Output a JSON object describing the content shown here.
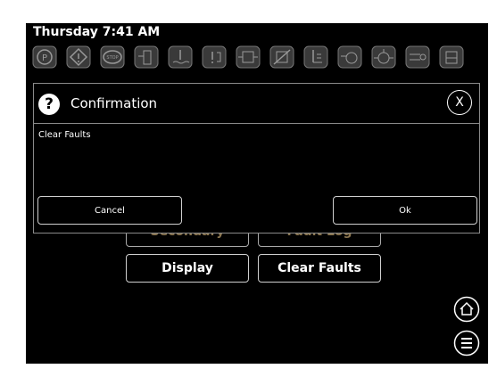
{
  "status": {
    "clock": "Thursday 7:41 AM"
  },
  "indicators": [
    "parking-brake-icon",
    "warning-icon",
    "stop-icon",
    "fuel-filter-icon",
    "coolant-icon",
    "fault-icon",
    "exhaust-filter-icon",
    "regen-inhibit-icon",
    "coolant-level-icon",
    "oil-pressure-icon",
    "lube-icon",
    "glow-plug-icon",
    "def-icon"
  ],
  "menu": {
    "secondary_label": "Secondary",
    "faultlog_label": "Fault Log",
    "display_label": "Display",
    "clear_faults_label": "Clear Faults"
  },
  "dialog": {
    "icon_text": "?",
    "title": "Confirmation",
    "close_text": "X",
    "message": "Clear Faults",
    "cancel_label": "Cancel",
    "ok_label": "Ok"
  },
  "colors": {
    "background": "#000000",
    "text": "#ffffff",
    "border": "#cfcfcf",
    "hidden_text": "#8a7550"
  }
}
